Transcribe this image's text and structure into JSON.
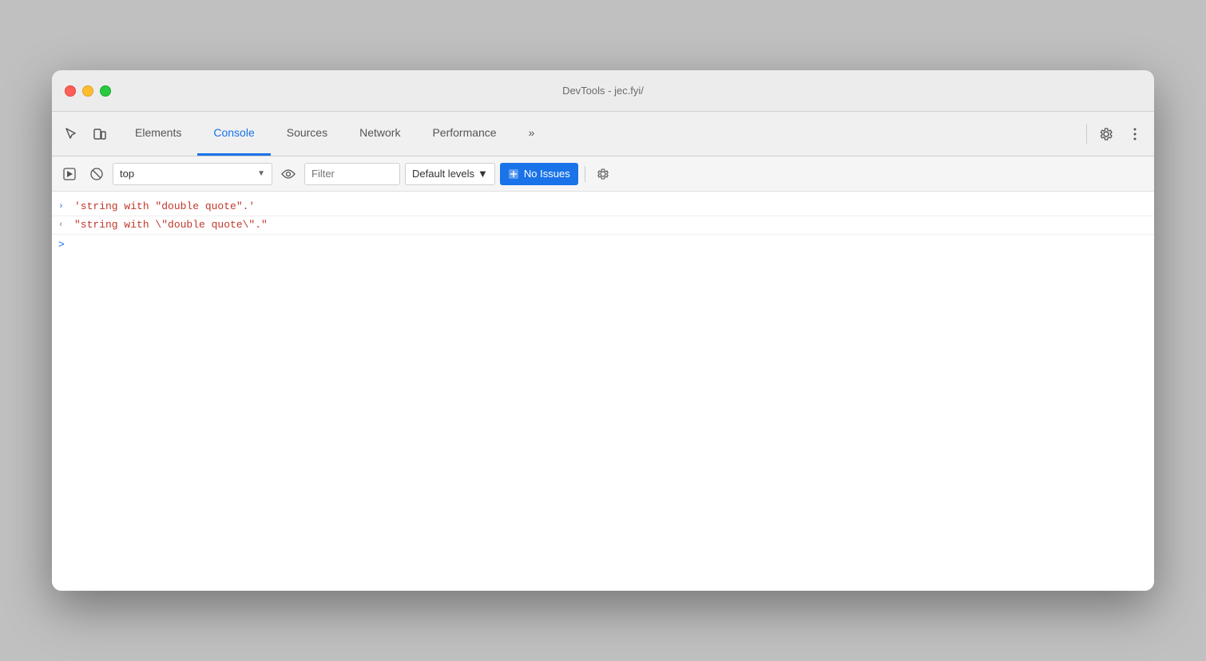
{
  "window": {
    "title": "DevTools - jec.fyi/"
  },
  "toolbar": {
    "tabs": [
      {
        "id": "elements",
        "label": "Elements",
        "active": false
      },
      {
        "id": "console",
        "label": "Console",
        "active": true
      },
      {
        "id": "sources",
        "label": "Sources",
        "active": false
      },
      {
        "id": "network",
        "label": "Network",
        "active": false
      },
      {
        "id": "performance",
        "label": "Performance",
        "active": false
      },
      {
        "id": "more",
        "label": "»",
        "active": false
      }
    ]
  },
  "console_toolbar": {
    "context_value": "top",
    "filter_placeholder": "Filter",
    "default_levels_label": "Default levels",
    "no_issues_label": "No Issues"
  },
  "console_output": {
    "lines": [
      {
        "id": "line1",
        "arrow": ">",
        "arrow_type": "blue",
        "text": "'string with \"double quote\".'"
      },
      {
        "id": "line2",
        "arrow": "<",
        "arrow_type": "gray",
        "text": "\"string with \\\"double quote\\\".\""
      }
    ],
    "input_prompt": ">"
  }
}
